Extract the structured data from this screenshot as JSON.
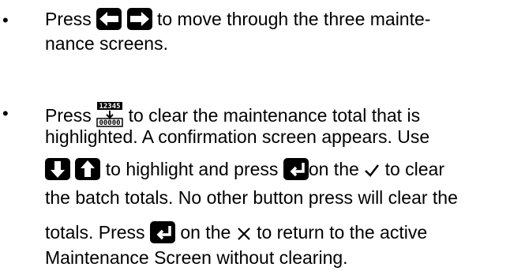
{
  "para1": {
    "bullet": "•",
    "line1_pre": "Press",
    "line1_post": "to move through the three mainte-",
    "line2": "nance screens."
  },
  "para2": {
    "bullet": "•",
    "line1_pre": "Press",
    "line1_post": "to clear the maintenance total that is",
    "line2": "highlighted. A confirmation screen appears. Use",
    "line3_mid": "to highlight and press",
    "line3_on": "on the",
    "line3_post": "to clear",
    "line4": "the batch totals. No other button press will clear the",
    "line5_pre": "totals. Press",
    "line5_on": "on the",
    "line5_post": "to return to the active",
    "line6": "Maintenance Screen without clearing."
  },
  "icons": {
    "reset_top": "12345",
    "reset_bottom": "00000"
  }
}
